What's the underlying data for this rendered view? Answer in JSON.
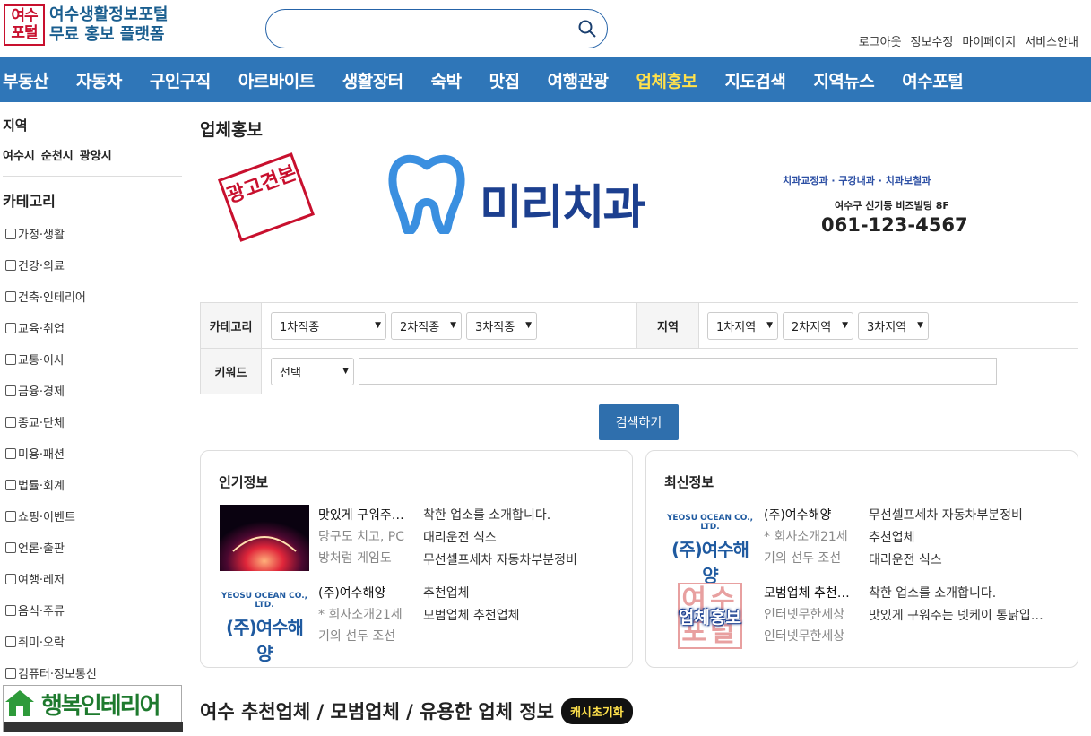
{
  "logo": {
    "mark_line1": "여수",
    "mark_line2": "포털",
    "line1": "여수생활정보포털",
    "line2": "무료 홍보 플랫폼"
  },
  "search": {
    "placeholder": ""
  },
  "toplinks": [
    "로그아웃",
    "정보수정",
    "마이페이지",
    "서비스안내"
  ],
  "nav": [
    "부동산",
    "자동차",
    "구인구직",
    "아르바이트",
    "생활장터",
    "숙박",
    "맛집",
    "여행관광",
    "업체홍보",
    "지도검색",
    "지역뉴스",
    "여수포털"
  ],
  "nav_active": "업체홍보",
  "sidebar": {
    "region_title": "지역",
    "regions": [
      "여수시",
      "순천시",
      "광양시"
    ],
    "category_title": "카테고리",
    "categories": [
      "가정·생활",
      "건강·의료",
      "건축·인테리어",
      "교육·취업",
      "교통·이사",
      "금융·경제",
      "종교·단체",
      "미용·패션",
      "법률·회계",
      "쇼핑·이벤트",
      "언론·출판",
      "여행·레저",
      "음식·주류",
      "취미·오락",
      "컴퓨터·정보통신"
    ],
    "ad_text": "행복인테리어"
  },
  "main": {
    "title": "업체홍보",
    "banner": {
      "stamp": "광고견본",
      "name": "미리치과",
      "tagline": "치과교정과 · 구강내과 · 치과보철과",
      "address": "여수구 신기동 비즈빌딩 8F",
      "phone": "061-123-4567"
    },
    "form": {
      "category_label": "카테고리",
      "cat1": "1차직종",
      "cat2": "2차직종",
      "cat3": "3차직종",
      "region_label": "지역",
      "reg1": "1차지역",
      "reg2": "2차지역",
      "reg3": "3차지역",
      "keyword_label": "키워드",
      "keyword_select": "선택",
      "keyword_value": ""
    },
    "search_button": "검색하기",
    "popular": {
      "title": "인기정보",
      "item1": {
        "title": "맛있게 구워주…",
        "desc1": "당구도 치고, PC",
        "desc2": "방처럼 게임도"
      },
      "item2": {
        "title": "(주)여수해양",
        "desc1": "* 회사소개21세",
        "desc2": "기의 선두 조선"
      },
      "links": [
        "착한 업소를 소개합니다.",
        "대리운전 식스",
        "무선셀프세차 자동차부분정비",
        "추천업체",
        "모범업체 추천업체"
      ]
    },
    "latest": {
      "title": "최신정보",
      "item1": {
        "title": "(주)여수해양",
        "desc1": "* 회사소개21세",
        "desc2": "기의 선두 조선"
      },
      "item2": {
        "title": "모범업체 추천…",
        "desc1": "인터넷무한세상",
        "desc2": "인터넷무한세상"
      },
      "links": [
        "무선셀프세차 자동차부분정비",
        "추천업체",
        "대리운전 식스",
        "착한 업소를 소개합니다.",
        "맛있게 구워주는 넷케이 통닭입…"
      ]
    },
    "thumb_yeosu": {
      "en": "YEOSU OCEAN CO., LTD.",
      "ko": "(주)여수해양"
    },
    "thumb_promo": {
      "bg": "여수포털",
      "label": "업체홍보"
    },
    "bottom_title": "여수 추천업체 / 모범업체 / 유용한 업체 정보",
    "cache_badge": "캐시초기화"
  },
  "colors": {
    "nav_bg": "#2f76b8",
    "accent": "#ffe14b",
    "brand": "#1c3f8f",
    "logo_red": "#c8102e"
  }
}
